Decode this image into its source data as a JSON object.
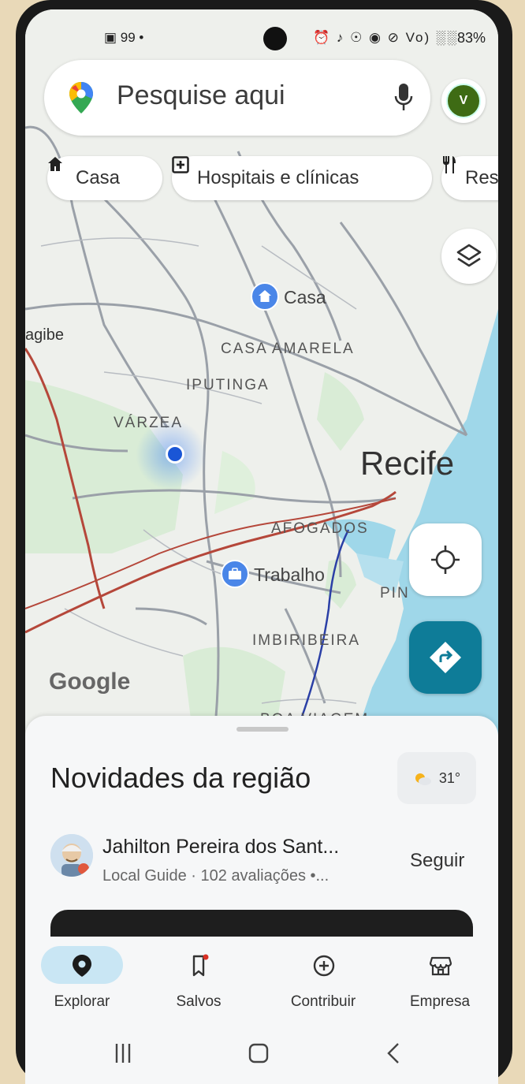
{
  "status": {
    "left": "▣ 99 •",
    "right_icons": "⏰ ♪ ☉ ◉ ⊘ Vo) ░░",
    "battery": "83%"
  },
  "search": {
    "placeholder": "Pesquise aqui",
    "mic_icon": "mic-icon",
    "avatar_initial": "V"
  },
  "chips": [
    {
      "label": "Casa",
      "icon": "home-icon"
    },
    {
      "label": "Hospitais e clínicas",
      "icon": "hospital-icon"
    },
    {
      "label": "Res",
      "icon": "restaurant-icon"
    }
  ],
  "map": {
    "places": {
      "casa": "Casa",
      "trabalho": "Trabalho",
      "recife": "Recife"
    },
    "neighborhoods": {
      "agibe": "agibe",
      "casa_amarela": "CASA AMARELA",
      "iputinga": "IPUTINGA",
      "varzea": "VÁRZEA",
      "afogados": "AFOGADOS",
      "pin": "PIN",
      "imbiribeira": "IMBIRIBEIRA",
      "boa_viagem": "BOA VIAGEM"
    },
    "attribution": "Google"
  },
  "sheet": {
    "title": "Novidades da região",
    "weather": "31°",
    "post": {
      "author": "Jahilton Pereira dos Sant...",
      "meta": "Local Guide · 102 avaliações  •...",
      "follow": "Seguir"
    }
  },
  "nav": [
    {
      "label": "Explorar",
      "icon": "explore-pin-icon",
      "active": true
    },
    {
      "label": "Salvos",
      "icon": "bookmark-icon",
      "active": false
    },
    {
      "label": "Contribuir",
      "icon": "add-circle-icon",
      "active": false
    },
    {
      "label": "Empresa",
      "icon": "storefront-icon",
      "active": false
    }
  ],
  "colors": {
    "accent": "#0e7c98",
    "active_pill": "#c9e6f4",
    "water": "#9fd7e9",
    "park": "#cfe8cf",
    "rail": "#b5473a"
  }
}
